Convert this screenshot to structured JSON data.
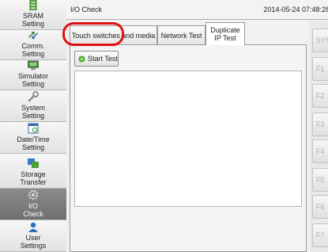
{
  "sidebar": {
    "items": [
      {
        "label_line1": "SRAM",
        "label_line2": "Setting",
        "icon": "sram-icon"
      },
      {
        "label_line1": "Comm.",
        "label_line2": "Setting",
        "icon": "comm-arrows-icon"
      },
      {
        "label_line1": "Simulator",
        "label_line2": "Setting",
        "icon": "monitor-icon"
      },
      {
        "label_line1": "System",
        "label_line2": "Setting",
        "icon": "wrench-icon"
      },
      {
        "label_line1": "Date/Time",
        "label_line2": "Setting",
        "icon": "calendar-icon"
      },
      {
        "label_line1": "Storage",
        "label_line2": "Transfer",
        "icon": "transfer-icon"
      },
      {
        "label_line1": "I/O",
        "label_line2": "Check",
        "icon": "gear-icon"
      },
      {
        "label_line1": "User",
        "label_line2": "Settings",
        "icon": "user-icon"
      }
    ]
  },
  "header": {
    "title": "I/O Check",
    "datetime": "2014-05-24 07:48:28"
  },
  "tabs": [
    {
      "label_line1": "Touch switches and media",
      "label_line2": ""
    },
    {
      "label_line1": "Network Test",
      "label_line2": ""
    },
    {
      "label_line1": "Duplicate",
      "label_line2": "IP Test"
    }
  ],
  "active_tab": "Duplicate IP Test",
  "start_button": {
    "label": "Start Test"
  },
  "function_keys": [
    "SYS",
    "F1",
    "F2",
    "F3",
    "F4",
    "F5",
    "F6",
    "F7"
  ],
  "colors": {
    "highlight_ring": "#e01010",
    "start_icon": "#4caf2a",
    "active_sidebar": "#7d7d7d"
  }
}
